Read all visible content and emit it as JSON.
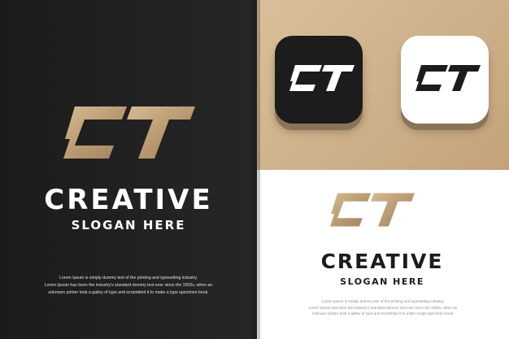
{
  "brand": {
    "monogram": "CT",
    "wordmark": "CREATIVE",
    "slogan": "SLOGAN HERE",
    "dummy_lines": [
      "Lorem Ipsum is simply dummy text of the printing and typesetting industry.",
      "Lorem Ipsum has been the industry's standard dummy text ever since the 1500s, when an",
      "unknown printer took a galley of type and scrambled it to make a type specimen book."
    ]
  },
  "colors": {
    "dark_bg": "#1b1b1b",
    "gold": "#c9ab84",
    "gold_dark": "#9b7f5c",
    "white": "#ffffff",
    "text_dark": "#1c1c1c"
  },
  "icons": {
    "logo_mark": "ct-monogram-icon",
    "app_icon_dark": "ct-app-icon-dark",
    "app_icon_light": "ct-app-icon-light"
  }
}
